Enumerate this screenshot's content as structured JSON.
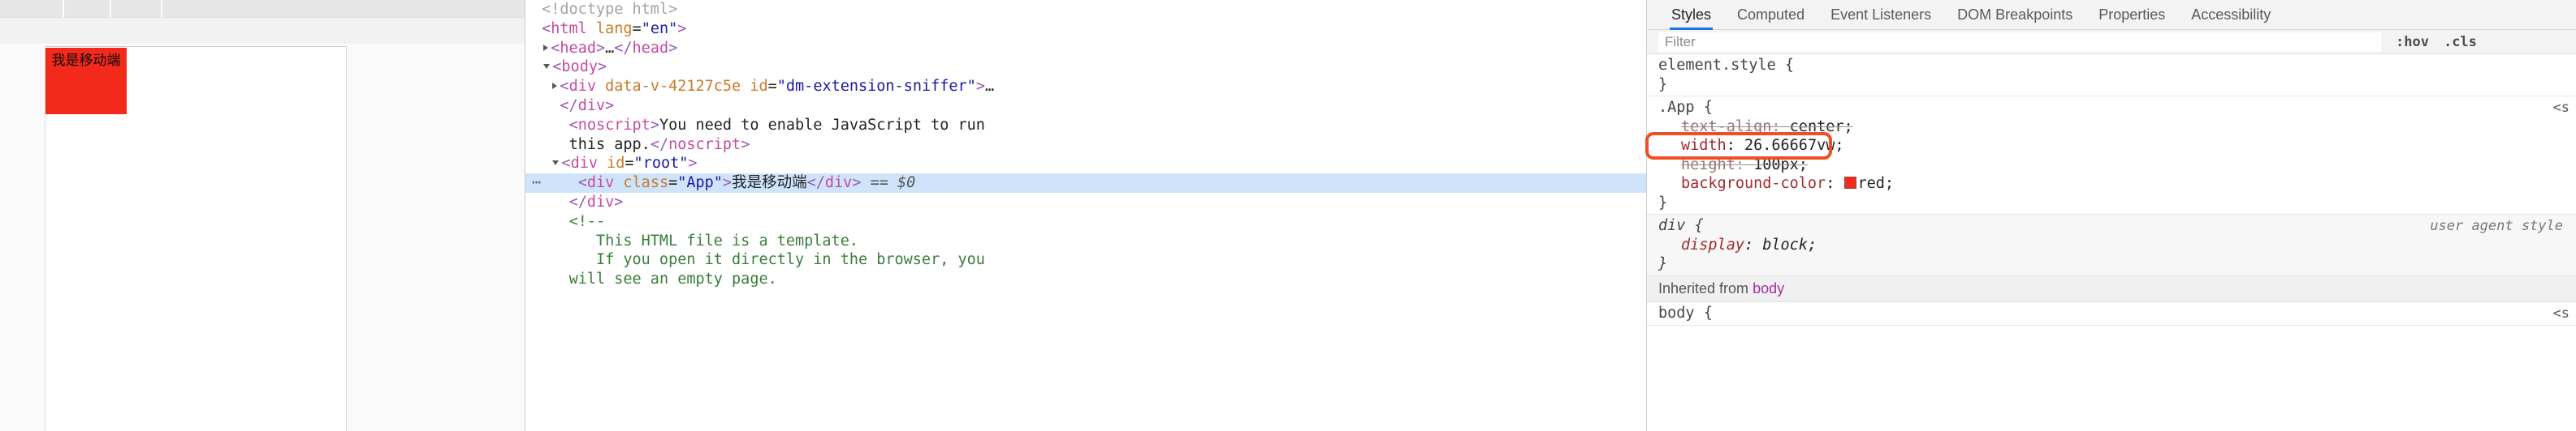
{
  "preview": {
    "app_box_text": "我是移动端",
    "app_box_color": "#f32a1b"
  },
  "dom_tree": {
    "rows": [
      {
        "indent": 0,
        "twisty": "none",
        "tokens": [
          {
            "c": "t-doctype",
            "t": "<!doctype html>"
          }
        ]
      },
      {
        "indent": 0,
        "twisty": "none",
        "tokens": [
          {
            "c": "t-punct",
            "t": "<"
          },
          {
            "c": "t-tag",
            "t": "html"
          },
          {
            "c": "t-text",
            "t": " "
          },
          {
            "c": "t-attr",
            "t": "lang"
          },
          {
            "c": "t-text",
            "t": "="
          },
          {
            "c": "t-val",
            "t": "\"en\""
          },
          {
            "c": "t-punct",
            "t": ">"
          }
        ]
      },
      {
        "indent": 1,
        "twisty": "closed",
        "tokens": [
          {
            "c": "t-punct",
            "t": "<"
          },
          {
            "c": "t-tag",
            "t": "head"
          },
          {
            "c": "t-punct",
            "t": ">"
          },
          {
            "c": "t-text",
            "t": "…"
          },
          {
            "c": "t-punct",
            "t": "</"
          },
          {
            "c": "t-tag",
            "t": "head"
          },
          {
            "c": "t-punct",
            "t": ">"
          }
        ]
      },
      {
        "indent": 1,
        "twisty": "open",
        "tokens": [
          {
            "c": "t-punct",
            "t": "<"
          },
          {
            "c": "t-tag",
            "t": "body"
          },
          {
            "c": "t-punct",
            "t": ">"
          }
        ]
      },
      {
        "indent": 2,
        "twisty": "closed",
        "tokens": [
          {
            "c": "t-punct",
            "t": "<"
          },
          {
            "c": "t-tag",
            "t": "div"
          },
          {
            "c": "t-text",
            "t": " "
          },
          {
            "c": "t-attr",
            "t": "data-v-42127c5e"
          },
          {
            "c": "t-text",
            "t": " "
          },
          {
            "c": "t-attr",
            "t": "id"
          },
          {
            "c": "t-text",
            "t": "="
          },
          {
            "c": "t-val",
            "t": "\"dm-extension-sniffer\""
          },
          {
            "c": "t-punct",
            "t": ">"
          },
          {
            "c": "t-text",
            "t": "…"
          }
        ]
      },
      {
        "indent": 2,
        "twisty": "none",
        "tokens": [
          {
            "c": "t-punct",
            "t": "</"
          },
          {
            "c": "t-tag",
            "t": "div"
          },
          {
            "c": "t-punct",
            "t": ">"
          }
        ]
      },
      {
        "indent": 3,
        "twisty": "none",
        "tokens": [
          {
            "c": "t-punct",
            "t": "<"
          },
          {
            "c": "t-tag",
            "t": "noscript"
          },
          {
            "c": "t-punct",
            "t": ">"
          },
          {
            "c": "t-text",
            "t": "You need to enable JavaScript to run"
          }
        ]
      },
      {
        "indent": 3,
        "twisty": "none",
        "tokens": [
          {
            "c": "t-text",
            "t": "this app."
          },
          {
            "c": "t-punct",
            "t": "</"
          },
          {
            "c": "t-tag",
            "t": "noscript"
          },
          {
            "c": "t-punct",
            "t": ">"
          }
        ]
      },
      {
        "indent": 2,
        "twisty": "open",
        "tokens": [
          {
            "c": "t-punct",
            "t": "<"
          },
          {
            "c": "t-tag",
            "t": "div"
          },
          {
            "c": "t-text",
            "t": " "
          },
          {
            "c": "t-attr",
            "t": "id"
          },
          {
            "c": "t-text",
            "t": "="
          },
          {
            "c": "t-val",
            "t": "\"root\""
          },
          {
            "c": "t-punct",
            "t": ">"
          }
        ]
      },
      {
        "indent": 4,
        "twisty": "none",
        "selected": true,
        "dots": "…",
        "tokens": [
          {
            "c": "t-punct",
            "t": "<"
          },
          {
            "c": "t-tag",
            "t": "div"
          },
          {
            "c": "t-text",
            "t": " "
          },
          {
            "c": "t-attr",
            "t": "class"
          },
          {
            "c": "t-text",
            "t": "="
          },
          {
            "c": "t-val",
            "t": "\"App\""
          },
          {
            "c": "t-punct",
            "t": ">"
          },
          {
            "c": "t-text",
            "t": "我是移动端"
          },
          {
            "c": "t-punct",
            "t": "</"
          },
          {
            "c": "t-tag",
            "t": "div"
          },
          {
            "c": "t-punct",
            "t": ">"
          },
          {
            "c": "t-selsuffix",
            "t": " == $0"
          }
        ]
      },
      {
        "indent": 3,
        "twisty": "none",
        "tokens": [
          {
            "c": "t-punct",
            "t": "</"
          },
          {
            "c": "t-tag",
            "t": "div"
          },
          {
            "c": "t-punct",
            "t": ">"
          }
        ]
      },
      {
        "indent": 3,
        "twisty": "none",
        "tokens": [
          {
            "c": "t-comment",
            "t": "<!--"
          }
        ]
      },
      {
        "indent": 6,
        "twisty": "none",
        "tokens": [
          {
            "c": "t-comment",
            "t": "This HTML file is a template."
          }
        ]
      },
      {
        "indent": 6,
        "twisty": "none",
        "tokens": [
          {
            "c": "t-comment",
            "t": "If you open it directly in the browser, you"
          }
        ]
      },
      {
        "indent": 3,
        "twisty": "none",
        "tokens": [
          {
            "c": "t-comment",
            "t": "will see an empty page."
          }
        ]
      }
    ]
  },
  "styles": {
    "tabs": [
      {
        "label": "Styles",
        "active": true
      },
      {
        "label": "Computed",
        "active": false
      },
      {
        "label": "Event Listeners",
        "active": false
      },
      {
        "label": "DOM Breakpoints",
        "active": false
      },
      {
        "label": "Properties",
        "active": false
      },
      {
        "label": "Accessibility",
        "active": false
      }
    ],
    "filter": {
      "placeholder": "Filter",
      "value": ""
    },
    "filter_actions": [
      {
        "label": ":hov"
      },
      {
        "label": ".cls"
      }
    ],
    "rules": [
      {
        "selector": "element.style {",
        "close": "}",
        "origin": "",
        "link": "",
        "ua": false,
        "declarations": []
      },
      {
        "selector": ".App {",
        "close": "}",
        "origin": "",
        "link": "<s",
        "ua": false,
        "declarations": [
          {
            "prop": "text-align",
            "value": "center;",
            "disabled": true,
            "swatch": ""
          },
          {
            "prop": "width",
            "value": "26.66667vw;",
            "disabled": false,
            "swatch": "",
            "highlighted": true
          },
          {
            "prop": "height",
            "value": "100px;",
            "disabled": true,
            "swatch": ""
          },
          {
            "prop": "background-color",
            "value": "red;",
            "disabled": false,
            "swatch": "#f32a1b"
          }
        ]
      },
      {
        "selector": "div {",
        "close": "}",
        "origin": "user agent style",
        "link": "",
        "ua": true,
        "declarations": [
          {
            "prop": "display",
            "value": "block;",
            "disabled": false,
            "swatch": ""
          }
        ]
      }
    ],
    "inherited_header": {
      "prefix": "Inherited from",
      "node": "body"
    },
    "inherited_rules": [
      {
        "selector": "body {",
        "close": "",
        "origin": "",
        "link": "<s",
        "ua": false,
        "declarations": []
      }
    ]
  }
}
